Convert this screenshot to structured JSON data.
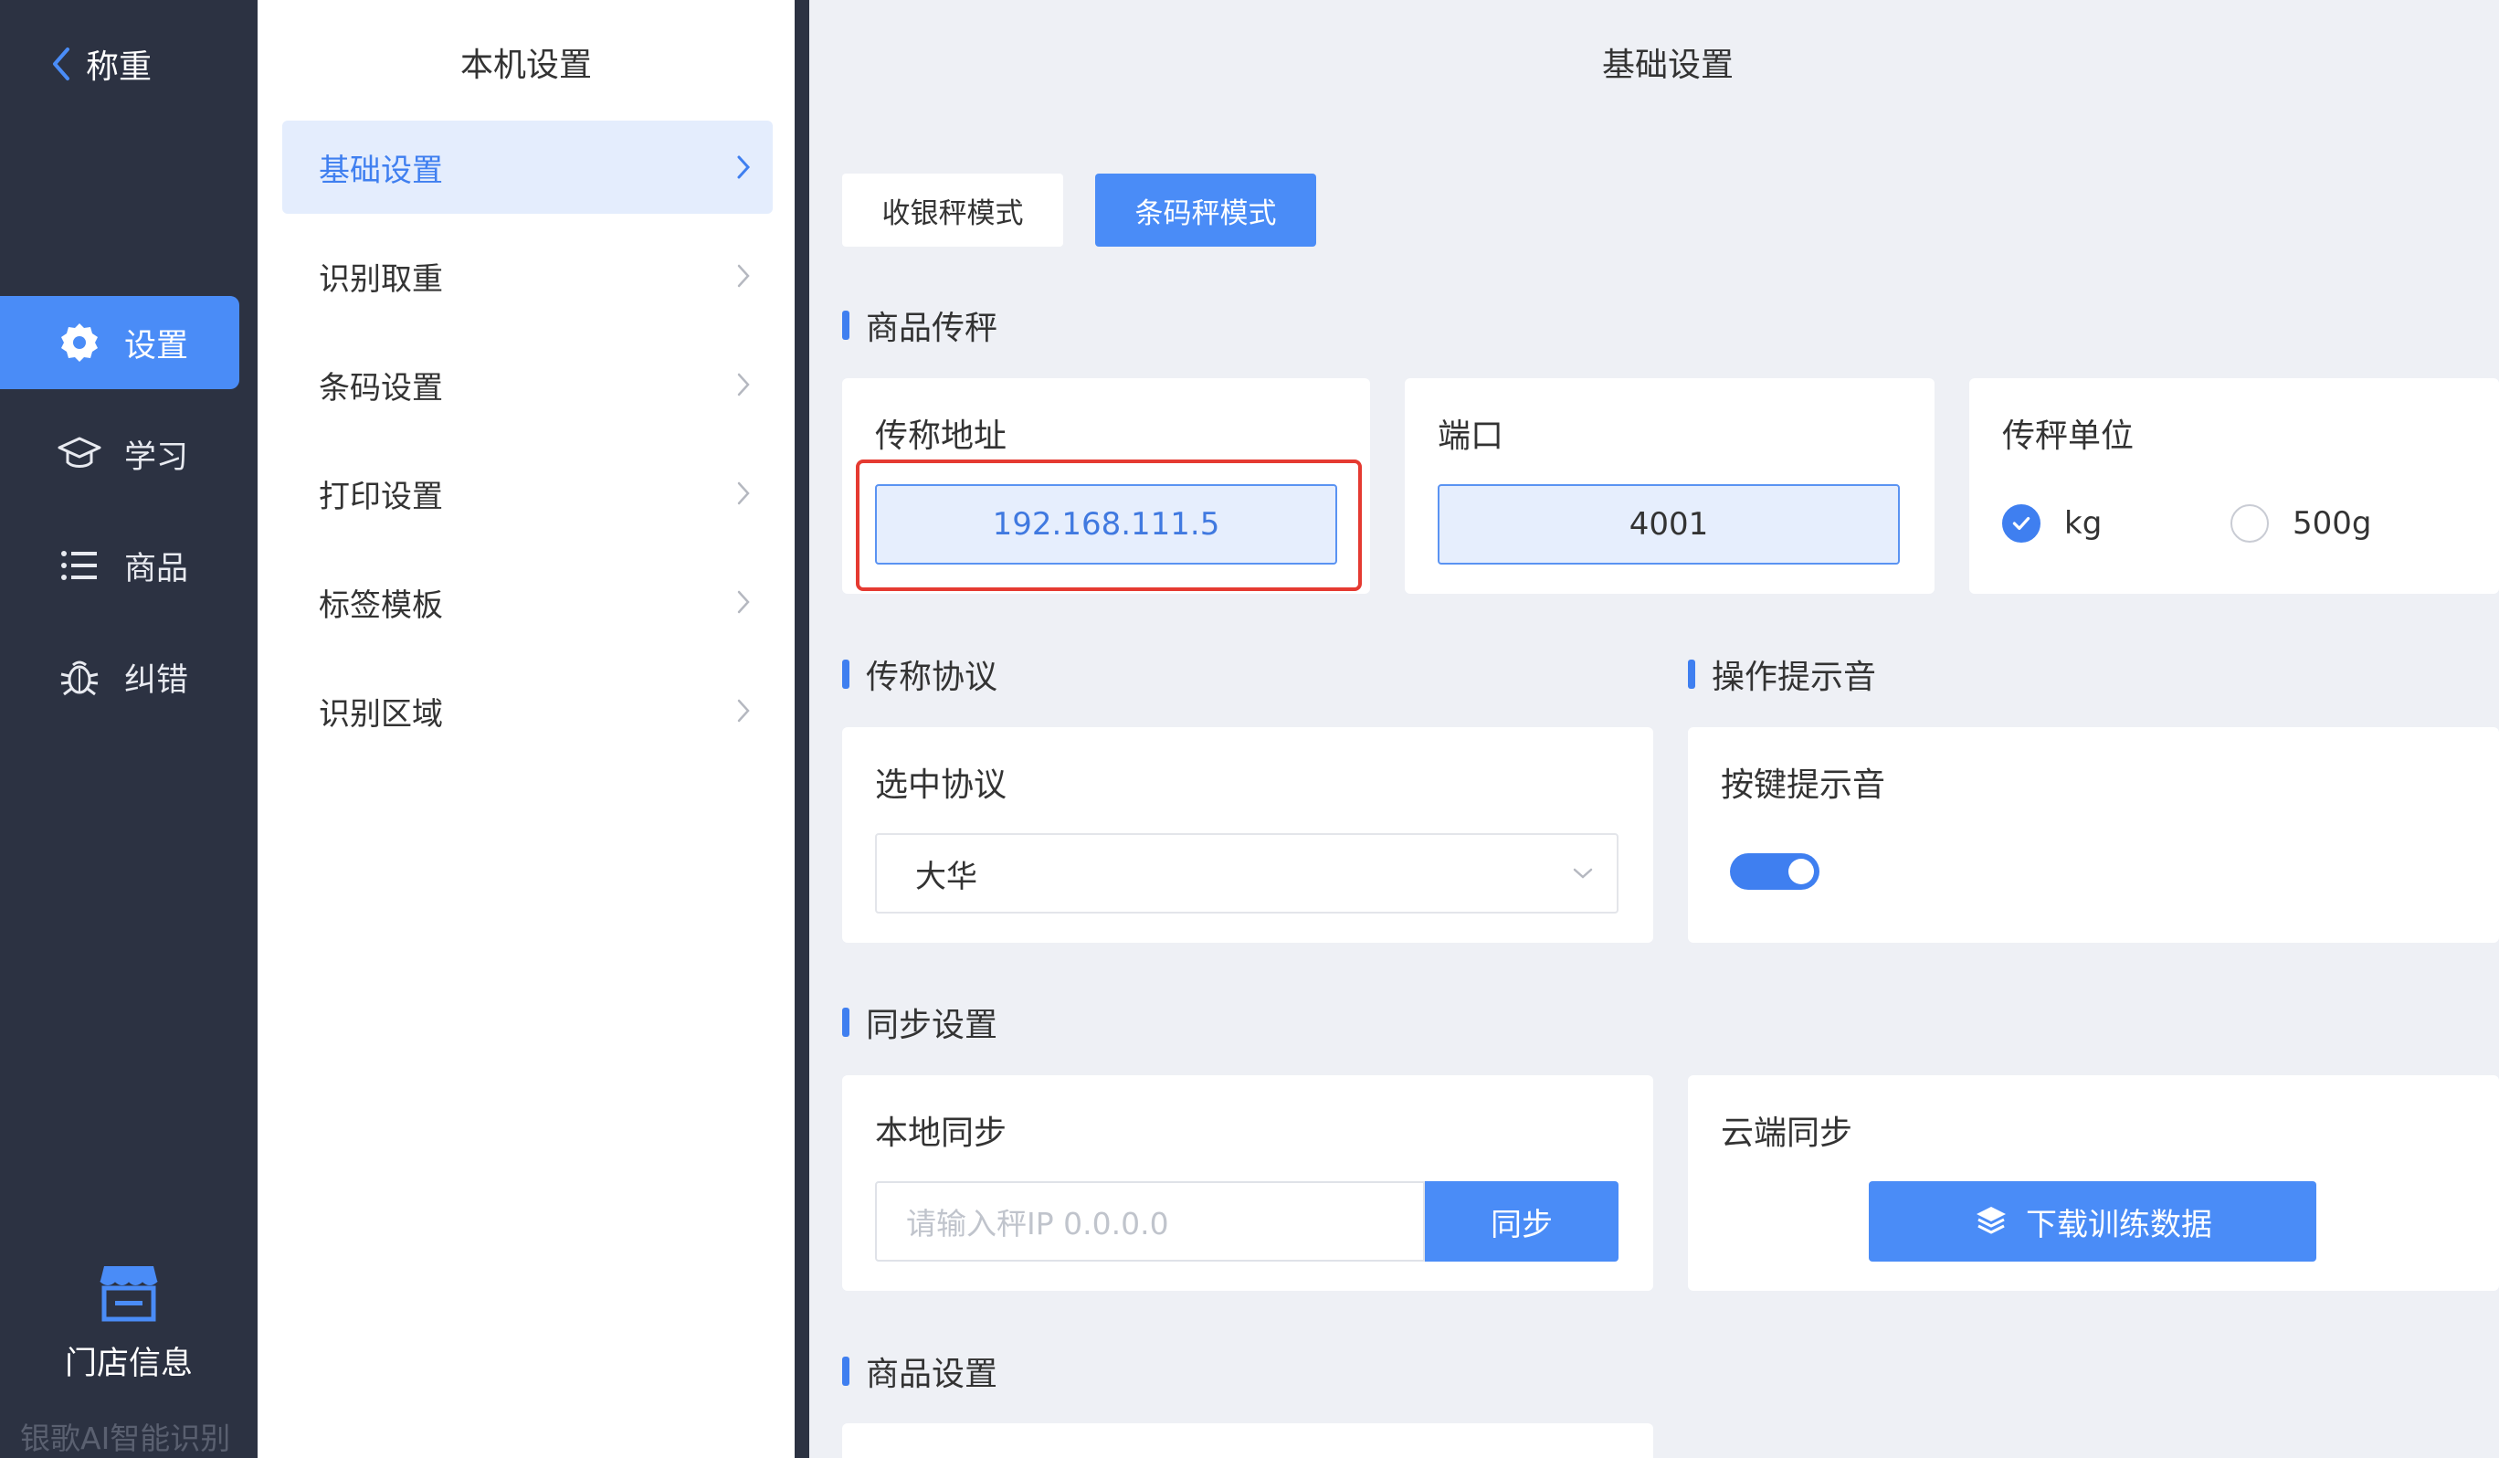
{
  "colors": {
    "accent": "#4a8cf7",
    "sidebar": "#2c3242",
    "highlight": "#e53a31",
    "background": "#eef0f5"
  },
  "leftnav": {
    "back_label": "称重",
    "items": [
      {
        "label": "设置",
        "icon": "gear-icon",
        "active": true
      },
      {
        "label": "学习",
        "icon": "graduation-cap-icon",
        "active": false
      },
      {
        "label": "商品",
        "icon": "list-icon",
        "active": false
      },
      {
        "label": "纠错",
        "icon": "bug-icon",
        "active": false
      }
    ],
    "store_label": "门店信息",
    "watermark": "银歌AI智能识别"
  },
  "midcol": {
    "title": "本机设置",
    "items": [
      {
        "label": "基础设置",
        "active": true
      },
      {
        "label": "识别取重",
        "active": false
      },
      {
        "label": "条码设置",
        "active": false
      },
      {
        "label": "打印设置",
        "active": false
      },
      {
        "label": "标签模板",
        "active": false
      },
      {
        "label": "识别区域",
        "active": false
      }
    ]
  },
  "main": {
    "title": "基础设置",
    "modes": [
      "收银秤模式",
      "条码秤模式"
    ],
    "active_mode": "条码秤模式",
    "sections": {
      "transfer": "商品传秤",
      "protocol": "传称协议",
      "sound": "操作提示音",
      "sync": "同步设置",
      "goods": "商品设置"
    },
    "address": {
      "label": "传称地址",
      "value": "192.168.111.5"
    },
    "port": {
      "label": "端口",
      "value": "4001"
    },
    "unit": {
      "label": "传秤单位",
      "options": [
        "kg",
        "500g"
      ],
      "selected": "kg"
    },
    "protocol_card": {
      "label": "选中协议",
      "value": "大华"
    },
    "sound_card": {
      "label": "按键提示音",
      "enabled": true
    },
    "local_sync": {
      "label": "本地同步",
      "placeholder": "请输入秤IP 0.0.0.0",
      "button": "同步"
    },
    "cloud_sync": {
      "label": "云端同步",
      "button": "下载训练数据"
    }
  }
}
